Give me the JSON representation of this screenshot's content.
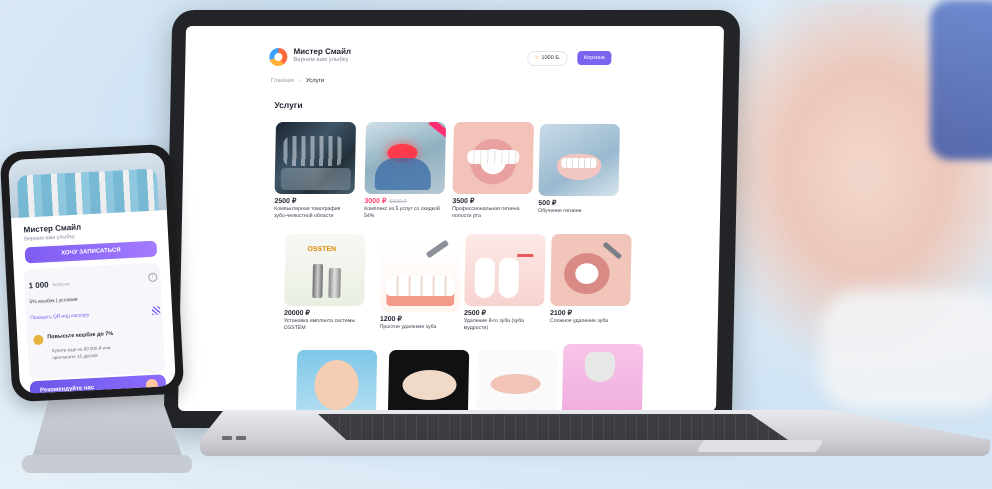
{
  "site": {
    "brand_name": "Мистер Смайл",
    "brand_sub": "Вернем вам улыбку",
    "balance": "1000 Б.",
    "cart_label": "Корзина",
    "breadcrumb": {
      "home": "Главная",
      "current": "Услуги"
    },
    "section_title": "Услуги",
    "services": [
      {
        "price": "2500 ₽",
        "old_price": "",
        "desc": "Компьютерная томография зубо-челюстной области"
      },
      {
        "price": "3000 ₽",
        "old_price": "6500 ₽",
        "desc": "Комплекс из 5 услуг со скидкой 54%"
      },
      {
        "price": "3500 ₽",
        "old_price": "",
        "desc": "Профессиональная гигиена полости рта"
      },
      {
        "price": "500 ₽",
        "old_price": "",
        "desc": "Обучение гигиене"
      },
      {
        "price": "20000 ₽",
        "old_price": "",
        "desc": "Установка импланта системы OSSTEM",
        "image_text": "OSSTEN"
      },
      {
        "price": "1200 ₽",
        "old_price": "",
        "desc": "Простое удаление зуба"
      },
      {
        "price": "2500 ₽",
        "old_price": "",
        "desc": "Удаление 8-го зуба (зуба мудрости)"
      },
      {
        "price": "2100 ₽",
        "old_price": "",
        "desc": "Сложное удаление зуба"
      }
    ]
  },
  "phone": {
    "brand_name": "Мистер Смайл",
    "brand_sub": "Вернем вам улыбку",
    "cta": "ХОЧУ ЗАПИСАТЬСЯ",
    "balance": "1 000",
    "balance_unit": "бонусов",
    "cashback": "5% кешбэк | условия",
    "qr_link": "Показать QR-код кассиру",
    "boost_title": "Повысьте кешбэк до 7%",
    "boost_desc1": "Купите еще на 80 000 ₽ или",
    "boost_desc2": "пригласите 15 друзей",
    "recommend": "Рекомендуйте нас"
  },
  "colors": {
    "accent": "#7b63f0",
    "sale": "#ff3b6b"
  },
  "icons": [
    "logo-icon",
    "star-icon",
    "chevron-right-icon",
    "info-icon",
    "qr-icon",
    "medal-icon"
  ]
}
